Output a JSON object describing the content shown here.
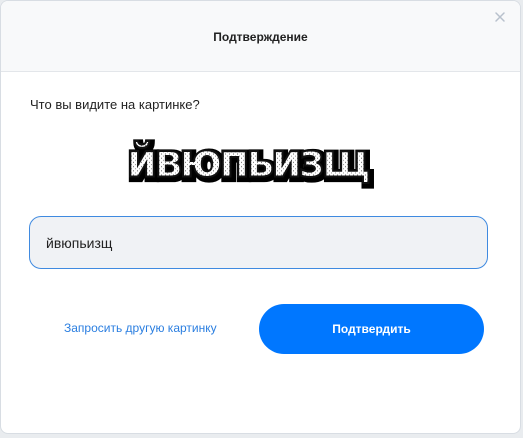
{
  "dialog": {
    "title": "Подтверждение",
    "close_icon": "close-icon"
  },
  "captcha": {
    "question": "Что вы видите на картинке?",
    "image_text": "йвюпьизщ",
    "input_value": "йвюпьизщ",
    "refresh_label": "Запросить другую картинку",
    "submit_label": "Подтвердить"
  },
  "colors": {
    "accent": "#0077ff",
    "link": "#2a7ee0",
    "input_border": "#3f8ae0",
    "input_bg": "#f0f2f5",
    "header_bg": "#f8f9fa"
  }
}
